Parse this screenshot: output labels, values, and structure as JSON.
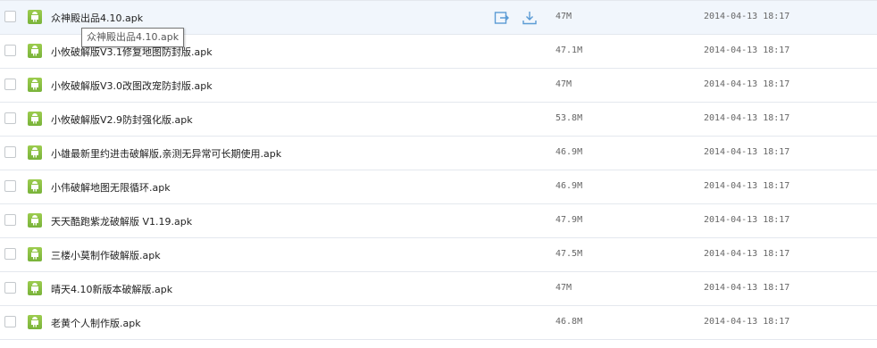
{
  "files": [
    {
      "name": "众神殿出品4.10.apk",
      "size": "47M",
      "date": "2014-04-13 18:17"
    },
    {
      "name": "小攸破解版V3.1修复地图防封版.apk",
      "size": "47.1M",
      "date": "2014-04-13 18:17"
    },
    {
      "name": "小攸破解版V3.0改图改宠防封版.apk",
      "size": "47M",
      "date": "2014-04-13 18:17"
    },
    {
      "name": "小攸破解版V2.9防封强化版.apk",
      "size": "53.8M",
      "date": "2014-04-13 18:17"
    },
    {
      "name": "小雄最新里约进击破解版,亲测无异常可长期使用.apk",
      "size": "46.9M",
      "date": "2014-04-13 18:17"
    },
    {
      "name": "小伟破解地图无限循环.apk",
      "size": "46.9M",
      "date": "2014-04-13 18:17"
    },
    {
      "name": "天天酷跑紫龙破解版 V1.19.apk",
      "size": "47.9M",
      "date": "2014-04-13 18:17"
    },
    {
      "name": "三楼小莫制作破解版.apk",
      "size": "47.5M",
      "date": "2014-04-13 18:17"
    },
    {
      "name": "晴天4.10新版本破解版.apk",
      "size": "47M",
      "date": "2014-04-13 18:17"
    },
    {
      "name": "老黄个人制作版.apk",
      "size": "46.8M",
      "date": "2014-04-13 18:17"
    }
  ],
  "tooltip": {
    "text": "众神殿出品4.10.apk"
  },
  "icons": {
    "file_type": "android-apk-icon",
    "share": "share-icon",
    "download": "download-icon"
  },
  "colors": {
    "hover_row": "#f1f6fc",
    "row_border": "#e4e8ee",
    "apk_icon": "#8bc34a",
    "action_icon": "#5b9bd5"
  }
}
